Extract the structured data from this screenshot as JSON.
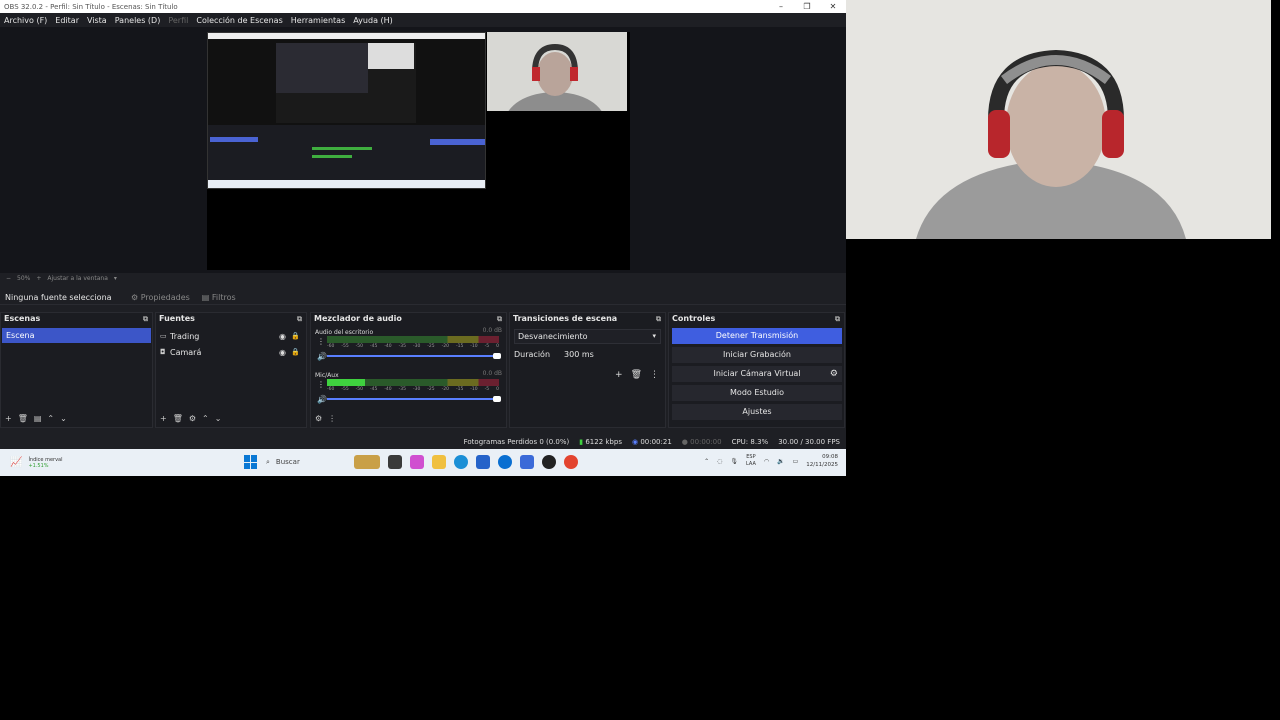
{
  "window": {
    "title": "OBS 32.0.2 - Perfil: Sin Título - Escenas: Sin Título"
  },
  "menu": [
    "Archivo (F)",
    "Editar",
    "Vista",
    "Paneles (D)",
    "Perfil",
    "Colección de Escenas",
    "Herramientas",
    "Ayuda (H)"
  ],
  "zoom": {
    "minus": "−",
    "level": "50%",
    "plus": "+",
    "fit": "Ajustar a la ventana"
  },
  "context": {
    "no_source": "Ninguna fuente selecciona",
    "properties": "Propiedades",
    "filters": "Filtros"
  },
  "scenes": {
    "title": "Escenas",
    "items": [
      "Escena"
    ]
  },
  "sources": {
    "title": "Fuentes",
    "items": [
      {
        "name": "Trading",
        "icon": "monitor-icon"
      },
      {
        "name": "Camará",
        "icon": "camera-icon"
      }
    ]
  },
  "mixer": {
    "title": "Mezclador de audio",
    "channels": [
      {
        "name": "Audio del escritorio",
        "db": "0.0 dB",
        "level": 0.0
      },
      {
        "name": "Mic/Aux",
        "db": "0.0 dB",
        "level": 0.22
      }
    ],
    "ticks": [
      "-60",
      "-55",
      "-50",
      "-45",
      "-40",
      "-35",
      "-30",
      "-25",
      "-20",
      "-15",
      "-10",
      "-5",
      "0"
    ]
  },
  "transitions": {
    "title": "Transiciones de escena",
    "selected": "Desvanecimiento",
    "duration_label": "Duración",
    "duration_value": "300 ms"
  },
  "controls": {
    "title": "Controles",
    "stop_stream": "Detener Transmisión",
    "start_record": "Iniciar Grabación",
    "virtual_cam": "Iniciar Cámara Virtual",
    "studio_mode": "Modo Estudio",
    "settings": "Ajustes"
  },
  "status": {
    "dropped": "Fotogramas Perdidos 0 (0.0%)",
    "bitrate": "6122 kbps",
    "stream_time": "00:00:21",
    "record_time": "00:00:00",
    "cpu": "CPU: 8.3%",
    "fps": "30.00 / 30.00 FPS"
  },
  "taskbar": {
    "widget_title": "Índice merval",
    "widget_sub": "+1.51%",
    "search": "Buscar",
    "lang1": "ESP",
    "lang2": "LAA",
    "time": "09:08",
    "date": "12/11/2025"
  },
  "colors": {
    "accent": "#3f5ee0",
    "bg": "#1e1f24",
    "meter_green": "#3fd13f"
  }
}
